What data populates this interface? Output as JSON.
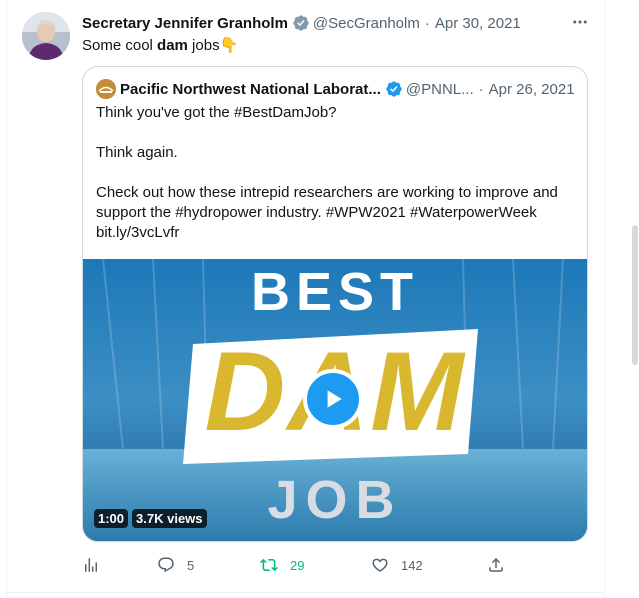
{
  "tweet": {
    "author_name": "Secretary Jennifer Granholm",
    "handle": "@SecGranholm",
    "separator": "·",
    "date": "Apr 30, 2021",
    "text_before": "Some cool ",
    "text_bold": "dam",
    "text_after": " jobs",
    "emoji": "👇"
  },
  "quoted": {
    "author_name": "Pacific Northwest National Laborat...",
    "handle": "@PNNL...",
    "separator": "·",
    "date": "Apr 26, 2021",
    "lines": [
      "Think you've got the #BestDamJob?",
      "Think again.",
      "Check out how these intrepid researchers are working to improve and",
      "support the #hydropower industry. #WPW2021 #WaterpowerWeek",
      "bit.ly/3vcLvfr"
    ],
    "video": {
      "headline_top": "BEST",
      "headline_middle": "DAM",
      "headline_bottom": "JOB",
      "duration": "1:00",
      "views": "3.7K views"
    }
  },
  "actions": {
    "replies": "5",
    "retweets": "29",
    "likes": "142"
  },
  "icons": [
    "verified-badge-icon",
    "more-icon",
    "play-icon",
    "analytics-icon",
    "reply-icon",
    "retweet-icon",
    "like-icon",
    "share-icon"
  ],
  "colors": {
    "accent": "#1d9bf0",
    "retweet_active": "#00ba7c",
    "muted": "#536471"
  }
}
